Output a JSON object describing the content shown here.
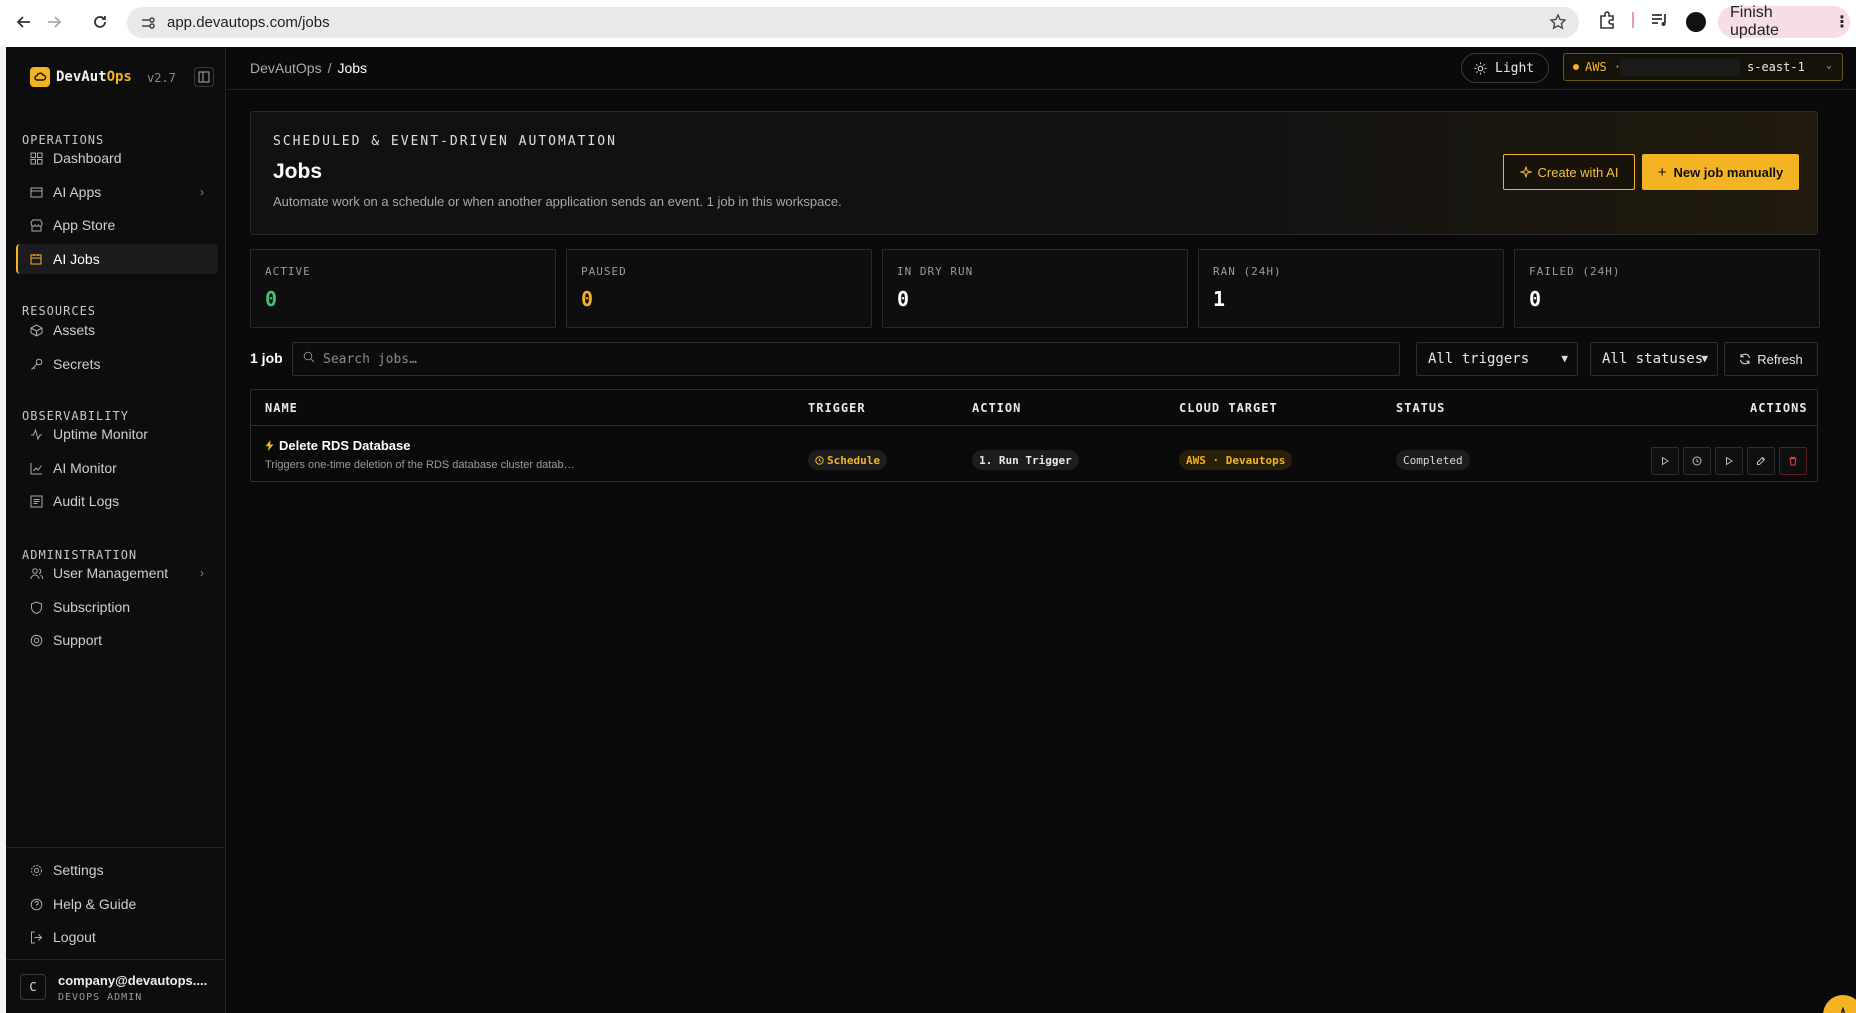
{
  "browser": {
    "url": "app.devautops.com/jobs",
    "finish_update": "Finish update"
  },
  "sidebar": {
    "brand": {
      "name_prefix": "DevAut",
      "name_suffix": "Ops",
      "version": "v2.7"
    },
    "sections": {
      "operations": "OPERATIONS",
      "resources": "RESOURCES",
      "observability": "OBSERVABILITY",
      "administration": "ADMINISTRATION"
    },
    "items": {
      "dashboard": "Dashboard",
      "ai_apps": "AI Apps",
      "app_store": "App Store",
      "ai_jobs": "AI Jobs",
      "assets": "Assets",
      "secrets": "Secrets",
      "uptime_monitor": "Uptime Monitor",
      "ai_monitor": "AI Monitor",
      "audit_logs": "Audit Logs",
      "user_management": "User Management",
      "subscription": "Subscription",
      "support": "Support",
      "settings": "Settings",
      "help": "Help & Guide",
      "logout": "Logout"
    },
    "active_item": "ai_jobs",
    "user": {
      "initial": "C",
      "email": "company@devautops....",
      "role": "DEVOPS ADMIN"
    }
  },
  "topbar": {
    "breadcrumb_root": "DevAutOps",
    "breadcrumb_sep": "/",
    "breadcrumb_current": "Jobs",
    "theme_label": "Light",
    "cloud_label": "AWS ·",
    "cloud_region": "s-east-1"
  },
  "hero": {
    "kicker": "SCHEDULED & EVENT-DRIVEN AUTOMATION",
    "title": "Jobs",
    "description": "Automate work on a schedule or when another application sends an event. 1 job in this workspace.",
    "create_ai": "Create with AI",
    "new_job": "New job manually"
  },
  "stats": [
    {
      "label": "ACTIVE",
      "value": "0",
      "color": "#3ec46d"
    },
    {
      "label": "PAUSED",
      "value": "0",
      "color": "#f4b322"
    },
    {
      "label": "IN DRY RUN",
      "value": "0",
      "color": "#ffffff"
    },
    {
      "label": "RAN (24H)",
      "value": "1",
      "color": "#ffffff"
    },
    {
      "label": "FAILED (24H)",
      "value": "0",
      "color": "#ffffff"
    }
  ],
  "filters": {
    "count": "1 job",
    "search_placeholder": "Search jobs…",
    "trigger_select": "All triggers",
    "status_select": "All statuses",
    "refresh": "Refresh"
  },
  "table": {
    "headers": {
      "name": "NAME",
      "trigger": "TRIGGER",
      "action": "ACTION",
      "cloud_target": "CLOUD TARGET",
      "status": "STATUS",
      "actions": "ACTIONS"
    },
    "rows": [
      {
        "name": "Delete RDS Database",
        "description": "Triggers one-time deletion of the RDS database cluster datab…",
        "trigger": "Schedule",
        "action": "1. Run Trigger",
        "cloud_target": "AWS · Devautops",
        "status": "Completed"
      }
    ]
  },
  "colors": {
    "accent": "#f4b322",
    "background": "#0a0a0b",
    "danger": "#e04646"
  }
}
